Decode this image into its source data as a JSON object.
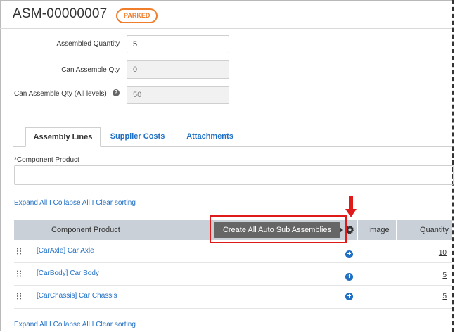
{
  "header": {
    "title": "ASM-00000007",
    "status_badge": "PARKED"
  },
  "form": {
    "assembled_quantity": {
      "label": "Assembled Quantity",
      "value": "5"
    },
    "can_assemble_qty": {
      "label": "Can Assemble Qty",
      "value": "0"
    },
    "can_assemble_qty_all": {
      "label": "Can Assemble Qty (All levels)",
      "value": "50",
      "help_icon": "question-circle-icon"
    }
  },
  "tabs": [
    {
      "label": "Assembly Lines",
      "active": true
    },
    {
      "label": "Supplier Costs",
      "active": false
    },
    {
      "label": "Attachments",
      "active": false
    }
  ],
  "component_field": {
    "label": "*Component Product",
    "value": ""
  },
  "table_links": {
    "expand_all": "Expand All",
    "separator": "I",
    "collapse_all": "Collapse All",
    "clear_sorting": "Clear sorting"
  },
  "table": {
    "columns": [
      "Component Product",
      "Image",
      "Quantity"
    ],
    "create_button": "Create All Auto Sub Assemblies",
    "settings_icon": "gear-icon",
    "rows": [
      {
        "product": "[CarAxle] Car Axle",
        "quantity": "10"
      },
      {
        "product": "[CarBody] Car Body",
        "quantity": "5"
      },
      {
        "product": "[CarChassis] Car Chassis",
        "quantity": "5"
      }
    ]
  },
  "annotation": {
    "arrow_color": "#e01a1a",
    "highlight_color": "#e01a1a"
  },
  "colors": {
    "accent_link": "#1f6fc5",
    "badge": "#f07d2a",
    "table_header": "#c9d0d8"
  }
}
